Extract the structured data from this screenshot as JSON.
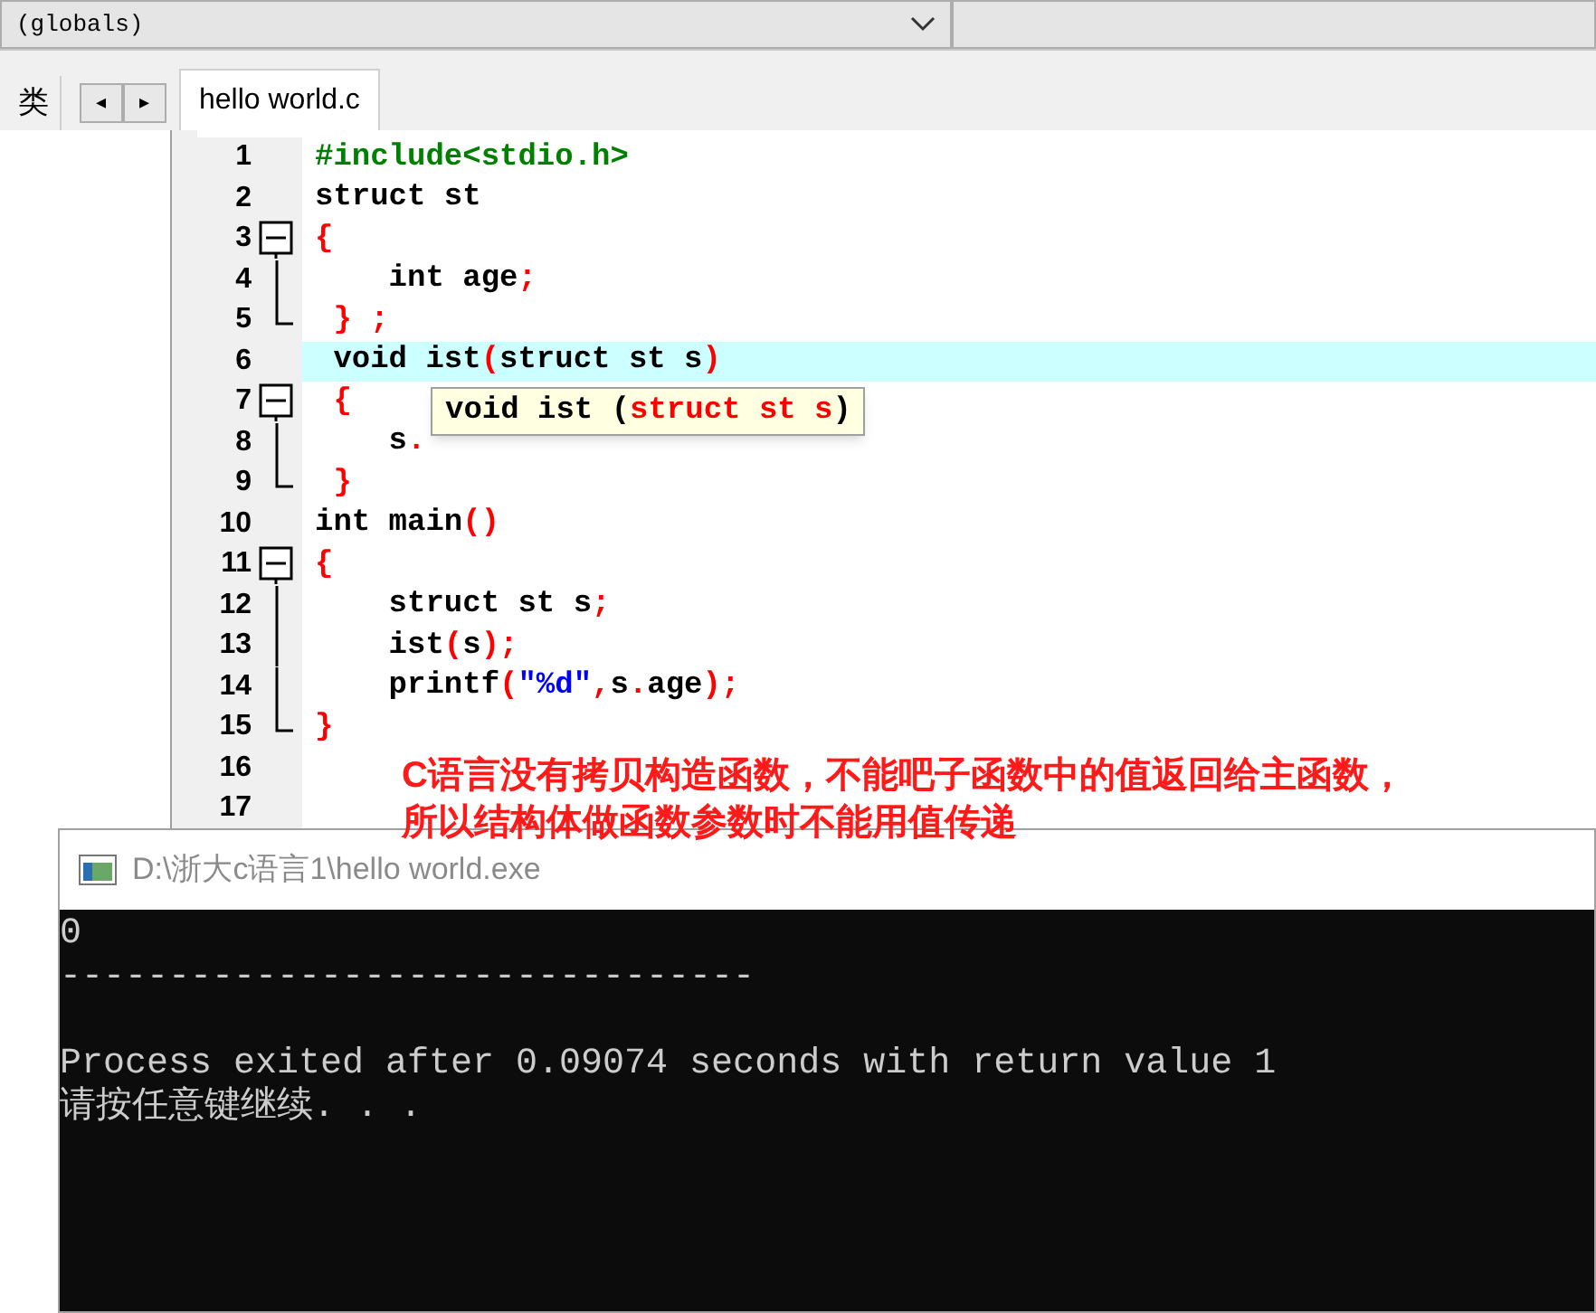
{
  "toolbar": {
    "scope_dropdown": "(globals)"
  },
  "side_panel": {
    "tab_label": "类",
    "prev_label": "◂",
    "next_label": "▸"
  },
  "tabs": [
    {
      "label": "hello world.c",
      "selected": true
    }
  ],
  "editor": {
    "lines": [
      {
        "number": "1",
        "kind": "plain",
        "highlighted": false,
        "tokens": [
          {
            "kind": "pre",
            "text": "#include<stdio.h>"
          }
        ]
      },
      {
        "number": "2",
        "kind": "plain",
        "highlighted": false,
        "tokens": [
          {
            "kind": "plain",
            "text": "struct st"
          }
        ]
      },
      {
        "number": "3",
        "kind": "foldstart",
        "highlighted": false,
        "tokens": [
          {
            "kind": "punct",
            "text": "{"
          }
        ]
      },
      {
        "number": "4",
        "kind": "foldbody",
        "highlighted": false,
        "tokens": [
          {
            "kind": "plain",
            "text": "    int age"
          },
          {
            "kind": "punct",
            "text": ";"
          }
        ]
      },
      {
        "number": "5",
        "kind": "foldend",
        "highlighted": false,
        "tokens": [
          {
            "kind": "punct",
            "text": " } ;"
          }
        ]
      },
      {
        "number": "6",
        "kind": "plain",
        "highlighted": true,
        "tokens": [
          {
            "kind": "plain",
            "text": " void ist"
          },
          {
            "kind": "punct",
            "text": "("
          },
          {
            "kind": "plain",
            "text": "struct st s"
          },
          {
            "kind": "punct",
            "text": ")"
          }
        ]
      },
      {
        "number": "7",
        "kind": "foldstart",
        "highlighted": false,
        "tokens": [
          {
            "kind": "punct",
            "text": " {"
          }
        ]
      },
      {
        "number": "8",
        "kind": "foldbody",
        "highlighted": false,
        "tokens": [
          {
            "kind": "plain",
            "text": "    s"
          },
          {
            "kind": "punct",
            "text": "."
          }
        ]
      },
      {
        "number": "9",
        "kind": "foldend",
        "highlighted": false,
        "tokens": [
          {
            "kind": "punct",
            "text": " }"
          }
        ]
      },
      {
        "number": "10",
        "kind": "plain",
        "highlighted": false,
        "tokens": [
          {
            "kind": "plain",
            "text": "int main"
          },
          {
            "kind": "punct",
            "text": "()"
          }
        ]
      },
      {
        "number": "11",
        "kind": "foldstart",
        "highlighted": false,
        "tokens": [
          {
            "kind": "punct",
            "text": "{"
          }
        ]
      },
      {
        "number": "12",
        "kind": "foldbody",
        "highlighted": false,
        "tokens": [
          {
            "kind": "plain",
            "text": "    struct st s"
          },
          {
            "kind": "punct",
            "text": ";"
          }
        ]
      },
      {
        "number": "13",
        "kind": "foldbody",
        "highlighted": false,
        "tokens": [
          {
            "kind": "plain",
            "text": "    ist"
          },
          {
            "kind": "punct",
            "text": "("
          },
          {
            "kind": "plain",
            "text": "s"
          },
          {
            "kind": "punct",
            "text": ");"
          }
        ]
      },
      {
        "number": "14",
        "kind": "foldbody",
        "highlighted": false,
        "tokens": [
          {
            "kind": "plain",
            "text": "    printf"
          },
          {
            "kind": "punct",
            "text": "("
          },
          {
            "kind": "str",
            "text": "\"%d\""
          },
          {
            "kind": "punct",
            "text": ","
          },
          {
            "kind": "plain",
            "text": "s"
          },
          {
            "kind": "punct",
            "text": "."
          },
          {
            "kind": "plain",
            "text": "age"
          },
          {
            "kind": "punct",
            "text": ");"
          }
        ]
      },
      {
        "number": "15",
        "kind": "foldend",
        "highlighted": false,
        "tokens": [
          {
            "kind": "punct",
            "text": "}"
          }
        ]
      },
      {
        "number": "16",
        "kind": "plain",
        "highlighted": false
      },
      {
        "number": "17",
        "kind": "plain",
        "highlighted": false
      }
    ],
    "tooltip": {
      "tokens": [
        {
          "kind": "plain",
          "text": "void ist ("
        },
        {
          "kind": "punct",
          "text": "struct st s"
        },
        {
          "kind": "plain",
          "text": ")"
        }
      ]
    }
  },
  "annotation": [
    "C语言没有拷贝构造函数，不能吧子函数中的值返回给主函数，",
    "所以结构体做函数参数时不能用值传递"
  ],
  "console": {
    "title": "D:\\浙大c语言1\\hello world.exe",
    "output": [
      {
        "kind": "text",
        "text": "0"
      },
      {
        "kind": "text",
        "text": "--------------------------------"
      },
      {
        "kind": "blank"
      },
      {
        "kind": "text",
        "text": "Process exited after 0.09074 seconds with return value 1"
      },
      {
        "kind": "text",
        "text": "请按任意键继续. . ."
      }
    ]
  }
}
